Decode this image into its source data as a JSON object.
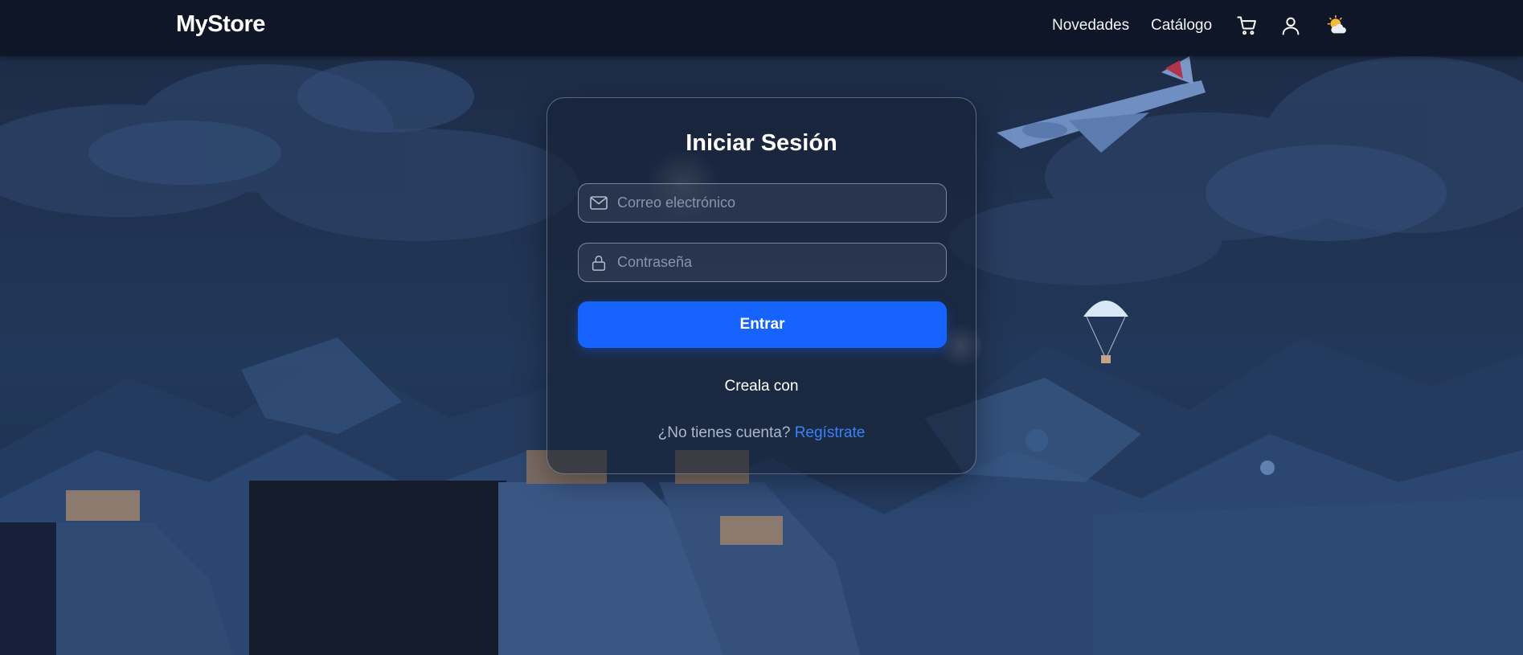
{
  "header": {
    "brand": "MyStore",
    "nav": {
      "novedades": "Novedades",
      "catalogo": "Catálogo"
    },
    "icons": [
      "cart-icon",
      "user-icon",
      "theme-toggle-icon"
    ]
  },
  "login": {
    "title": "Iniciar Sesión",
    "email_placeholder": "Correo electrónico",
    "email_value": "",
    "password_placeholder": "Contraseña",
    "password_value": "",
    "submit_label": "Entrar",
    "social_text": "Creala con",
    "no_account_text": "¿No tienes cuenta?",
    "register_link": "Regístrate"
  },
  "colors": {
    "primary": "#1763ff",
    "link": "#3b82f6",
    "header_bg": "#0e1627"
  }
}
